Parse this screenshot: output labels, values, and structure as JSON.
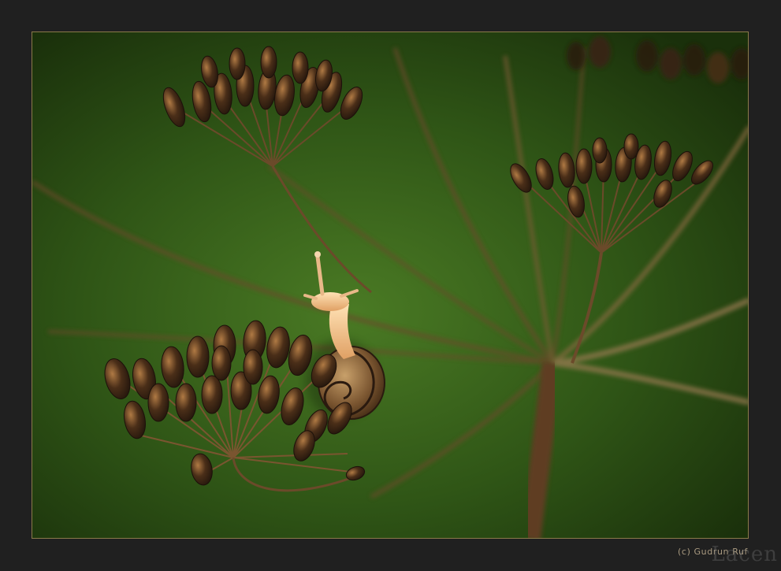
{
  "photo": {
    "subject": "snail on dill seed head",
    "palette": {
      "background_green": "#2e5315",
      "stem_brown": "#6b4a2a",
      "seed_dark": "#2a1a0f",
      "snail_body": "#f0c89a",
      "frame": "#202020",
      "frame_border": "#8a7a4a"
    }
  },
  "credit": {
    "copyright": "(c) Gudrun Ruf"
  },
  "watermark": {
    "text": "Lacen"
  }
}
